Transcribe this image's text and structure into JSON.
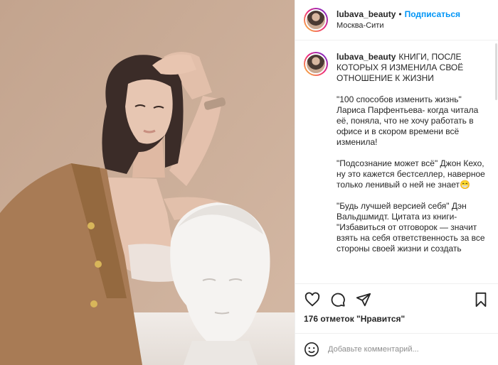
{
  "post": {
    "photo_alt": "",
    "header": {
      "username": "lubava_beauty",
      "separator": "•",
      "follow_label": "Подписаться",
      "location": "Москва-Сити"
    },
    "caption": {
      "username": "lubava_beauty",
      "paragraphs": [
        "КНИГИ, ПОСЛЕ КОТОРЫХ Я ИЗМЕНИЛА СВОЁ ОТНОШЕНИЕ К ЖИЗНИ",
        "\"100 способов изменить жизнь\" Лариса Парфентьева- когда читала её, поняла, что не хочу работать в офисе и в скором времени всё изменила!",
        "\"Подсознание может всё\" Джон Кехо, ну это кажется бестселлер, наверное только ленивый о ней не знает😁",
        "\"Будь лучшей версией себя\" Дэн Вальдшмидт. Цитата из книги- \"Избавиться от отговорок — значит взять на себя ответственность за все стороны своей жизни и создать"
      ]
    },
    "actions": {
      "likes_text": "176 отметок \"Нравится\""
    },
    "comment_box": {
      "placeholder": "Добавьте комментарий..."
    }
  },
  "icons": {
    "like": "heart-icon",
    "comment": "comment-icon",
    "share": "share-icon",
    "save": "bookmark-icon",
    "emoji": "emoji-icon"
  },
  "colors": {
    "accent": "#0095f6",
    "text": "#262626",
    "muted": "#8e8e8e",
    "border": "#efefef",
    "photo_background": "#c9aa93",
    "blazer": "#a87b55"
  }
}
